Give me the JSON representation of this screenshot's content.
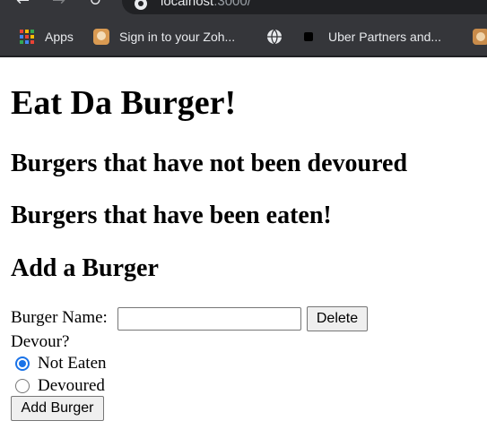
{
  "browser": {
    "url_host": "localhost",
    "url_port": ":3000/",
    "bookmarks": [
      {
        "label": "Apps",
        "icon": "apps-grid-icon"
      },
      {
        "label": "Sign in to your Zoh...",
        "icon": "zoho-favicon-icon"
      },
      {
        "label": "",
        "icon": "globe-icon"
      },
      {
        "label": "Uber Partners and...",
        "icon": "uber-favicon-icon"
      },
      {
        "label": "",
        "icon": "partial-favicon-icon"
      }
    ],
    "colors": {
      "chrome_bg": "#35363a",
      "omnibox_bg": "#202124",
      "chrome_text": "#e8eaed"
    }
  },
  "page": {
    "title": "Eat Da Burger!",
    "not_devoured_heading": "Burgers that have not been devoured",
    "eaten_heading": "Burgers that have been eaten!",
    "add_heading": "Add a Burger",
    "form": {
      "name_label": "Burger Name:",
      "name_value": "",
      "name_placeholder": "",
      "delete_label": "Delete",
      "devour_label": "Devour?",
      "options": [
        {
          "label": "Not Eaten",
          "checked": true
        },
        {
          "label": "Devoured",
          "checked": false
        }
      ],
      "submit_label": "Add Burger"
    },
    "colors": {
      "radio_checked": "#1a73e8",
      "button_bg": "#efefef",
      "button_border": "#767676"
    }
  }
}
